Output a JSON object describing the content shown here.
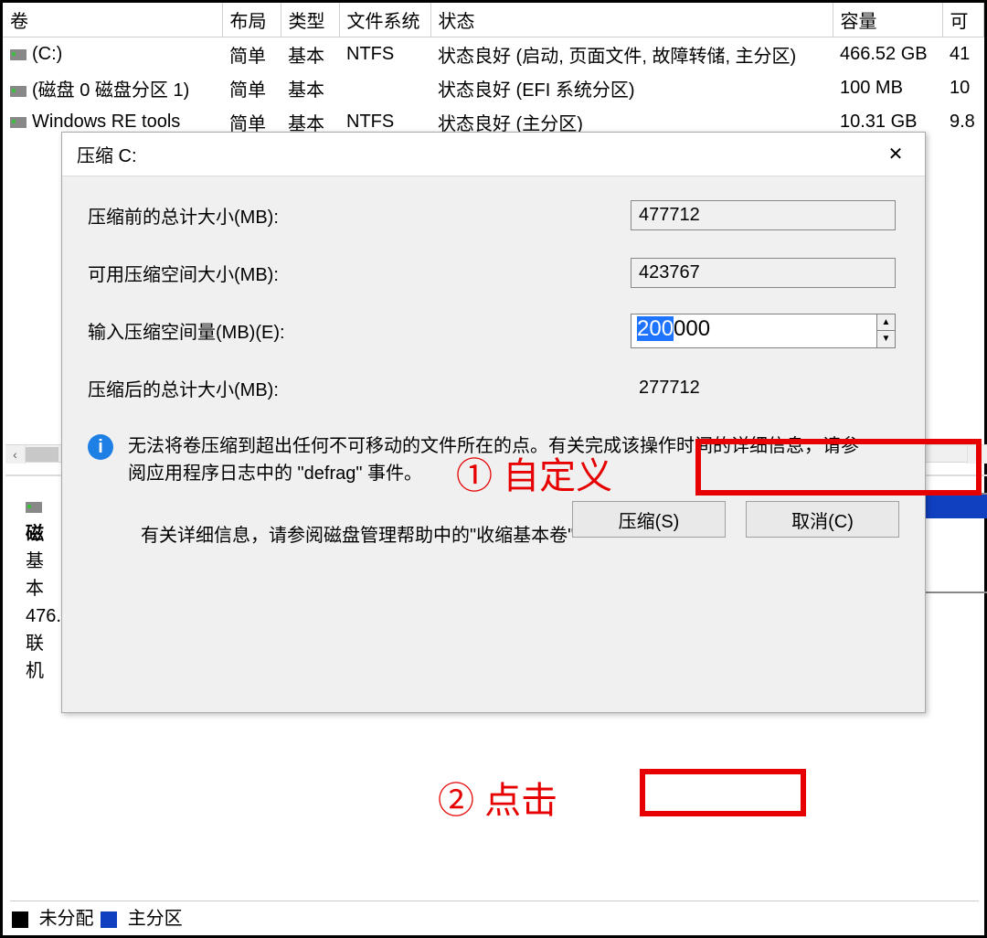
{
  "tableHeaders": {
    "vol": "卷",
    "layout": "布局",
    "type": "类型",
    "fs": "文件系统",
    "status": "状态",
    "capacity": "容量",
    "free": "可"
  },
  "volumes": [
    {
      "name": "(C:)",
      "layout": "简单",
      "type": "基本",
      "fs": "NTFS",
      "status": "状态良好 (启动, 页面文件, 故障转储, 主分区)",
      "capacity": "466.52 GB",
      "free": "41"
    },
    {
      "name": "(磁盘 0 磁盘分区 1)",
      "layout": "简单",
      "type": "基本",
      "fs": "",
      "status": "状态良好 (EFI 系统分区)",
      "capacity": "100 MB",
      "free": "10"
    },
    {
      "name": "Windows RE tools",
      "layout": "简单",
      "type": "基本",
      "fs": "NTFS",
      "status": "状态良好 (主分区)",
      "capacity": "10.31 GB",
      "free": "9.8"
    }
  ],
  "disk": {
    "titlePrefix": "磁",
    "line1": "基本",
    "line2": "476.",
    "line3": "联机"
  },
  "legend": {
    "unallocated": "未分配",
    "primary": "主分区"
  },
  "dialog": {
    "title": "压缩 C:",
    "labels": {
      "before": "压缩前的总计大小(MB):",
      "avail": "可用压缩空间大小(MB):",
      "enter": "输入压缩空间量(MB)(E):",
      "after": "压缩后的总计大小(MB):"
    },
    "values": {
      "before": "477712",
      "avail": "423767",
      "enter_hl": "200",
      "enter_rest": "000",
      "after": "277712"
    },
    "infoText": "无法将卷压缩到超出任何不可移动的文件所在的点。有关完成该操作时间的详细信息，请参阅应用程序日志中的 \"defrag\" 事件。",
    "moreInfo": "有关详细信息，请参阅磁盘管理帮助中的\"收缩基本卷\"",
    "buttons": {
      "shrink": "压缩(S)",
      "cancel": "取消(C)"
    }
  },
  "annotations": {
    "a1_num": "①",
    "a1_text": "自定义",
    "a2_num": "②",
    "a2_text": "点击"
  }
}
